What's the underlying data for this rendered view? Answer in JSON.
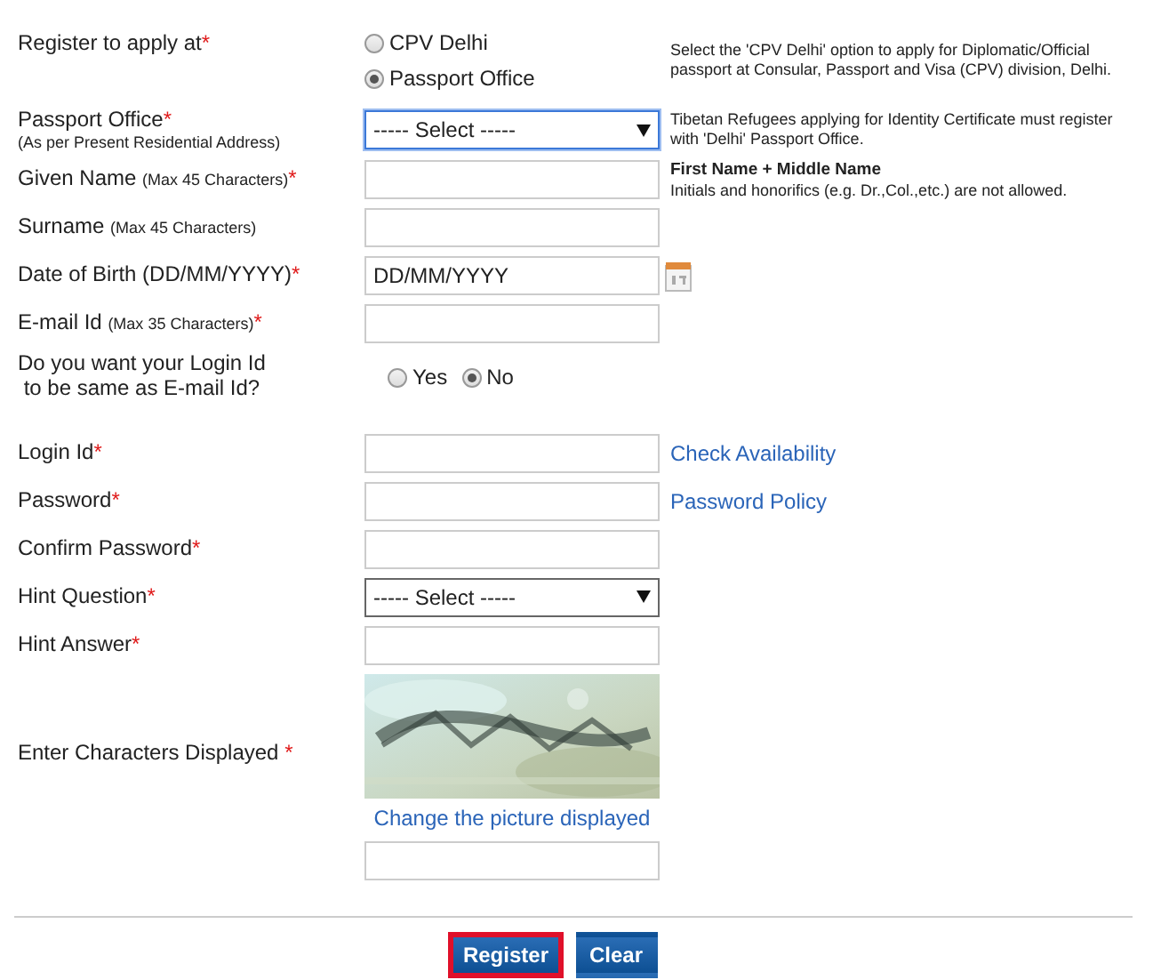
{
  "form": {
    "rows": [
      {
        "kind": "radio_stack",
        "label": "Register to apply at",
        "required_mark": "*",
        "options": [
          {
            "label": "CPV Delhi",
            "selected": false
          },
          {
            "label": "Passport Office",
            "selected": true
          }
        ],
        "note": "Select the 'CPV Delhi' option to apply for Diplomatic/Official passport at Consular, Passport and Visa (CPV) division, Delhi."
      },
      {
        "kind": "select",
        "label": "Passport Office",
        "required_mark": "*",
        "sublabel": "(As per Present Residential Address)",
        "value": "----- Select -----",
        "focused": true,
        "note": "Tibetan Refugees applying for Identity Certificate must register with 'Delhi' Passport Office."
      },
      {
        "kind": "text",
        "label": "Given Name",
        "hint": "(Max 45 Characters)",
        "required_mark": "*",
        "note_title": "First Name + Middle Name",
        "note": "Initials and honorifics (e.g. Dr.,Col.,etc.) are not allowed."
      },
      {
        "kind": "text",
        "label": "Surname",
        "hint": "(Max 45 Characters)"
      },
      {
        "kind": "date",
        "label": "Date of Birth (DD/MM/YYYY)",
        "required_mark": "*",
        "value": "DD/MM/YYYY"
      },
      {
        "kind": "text",
        "label": "E-mail Id",
        "hint": "(Max 35 Characters)",
        "required_mark": "*"
      },
      {
        "kind": "radio_inline",
        "label": "Do you want your Login Id\n to be same as E-mail Id?",
        "options": [
          {
            "label": "Yes",
            "selected": false
          },
          {
            "label": "No",
            "selected": true
          }
        ]
      },
      {
        "kind": "text",
        "label": "Login Id",
        "required_mark": "*",
        "link": "Check Availability"
      },
      {
        "kind": "text",
        "label": "Password",
        "required_mark": "*",
        "link": "Password Policy"
      },
      {
        "kind": "text",
        "label": "Confirm Password",
        "required_mark": "*"
      },
      {
        "kind": "select",
        "label": "Hint Question",
        "required_mark": "*",
        "value": "----- Select -----",
        "focused": false
      },
      {
        "kind": "text",
        "label": "Hint Answer",
        "required_mark": "*"
      },
      {
        "kind": "captcha",
        "label": "Enter Characters Displayed ",
        "required_mark": "*",
        "link": "Change the picture displayed"
      }
    ],
    "buttons": [
      {
        "label": "Register",
        "focused": true
      },
      {
        "label": "Clear",
        "focused": false
      }
    ]
  }
}
